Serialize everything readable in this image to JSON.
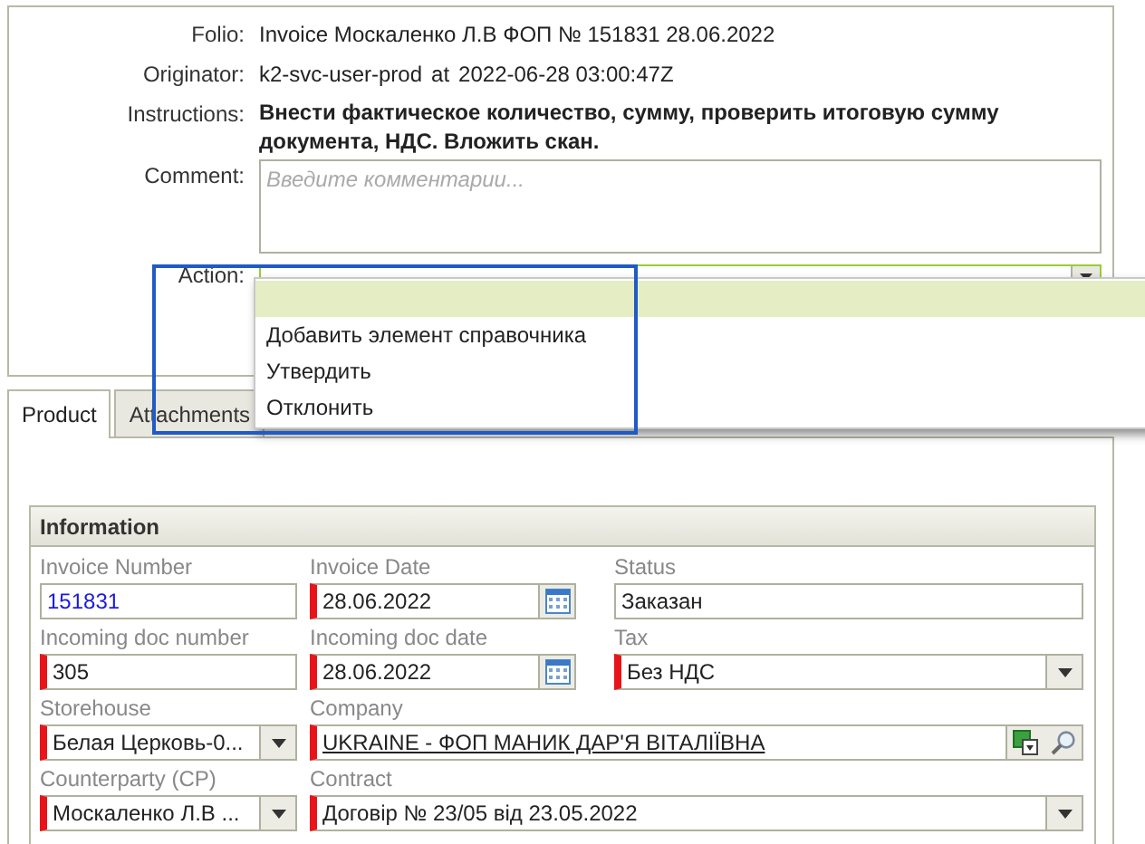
{
  "task": {
    "folio_label": "Folio:",
    "folio": "Invoice Москаленко Л.В ФОП № 151831 28.06.2022",
    "originator_label": "Originator:",
    "originator": "k2-svc-user-prod",
    "at": "at",
    "originated": "2022-06-28 03:00:47Z",
    "instructions_label": "Instructions:",
    "instructions": "Внести фактическое количество, сумму, проверить итоговую сумму документа, НДС. Вложить скан.",
    "comment_label": "Comment:",
    "comment_placeholder": "Введите комментарии...",
    "action_label": "Action:",
    "action_options": [
      {
        "selected": true
      },
      {
        "label": "Добавить элемент справочника",
        "selected": false
      },
      {
        "label": "Утвердить",
        "selected": false
      },
      {
        "label": "Отклонить",
        "selected": false
      }
    ]
  },
  "tabs": [
    {
      "label": "Product",
      "selected": true
    },
    {
      "label": "Attachments",
      "selected": false
    }
  ],
  "information": {
    "title": "Information",
    "rows": [
      [
        {
          "label": "Invoice Number",
          "value": "151831",
          "kind": "link",
          "required": false
        },
        {
          "label": "Invoice Date",
          "value": "28.06.2022",
          "kind": "date",
          "required": true
        },
        {
          "label": "Status",
          "value": "Заказан",
          "kind": "text",
          "required": false
        }
      ],
      [
        {
          "label": "Incoming doc number",
          "value": "305",
          "kind": "text",
          "required": true
        },
        {
          "label": "Incoming doc date",
          "value": "28.06.2022",
          "kind": "date",
          "required": true
        },
        {
          "label": "Tax",
          "value": "Без НДС",
          "kind": "select",
          "required": true
        }
      ],
      [
        {
          "label": "Storehouse",
          "value": "Белая Церковь-0...",
          "kind": "select",
          "required": true
        },
        {
          "label": "Company",
          "value": "UKRAINE - ФОП МАНИК ДАР'Я ВІТАЛІЇВНА",
          "kind": "lookup",
          "required": true
        }
      ],
      [
        {
          "label": "Counterparty (CP)",
          "value": "Москаленко Л.В ...",
          "kind": "select",
          "required": true
        },
        {
          "label": "Contract",
          "value": "Договір № 23/05 від 23.05.2022",
          "kind": "select",
          "required": true
        }
      ]
    ]
  }
}
